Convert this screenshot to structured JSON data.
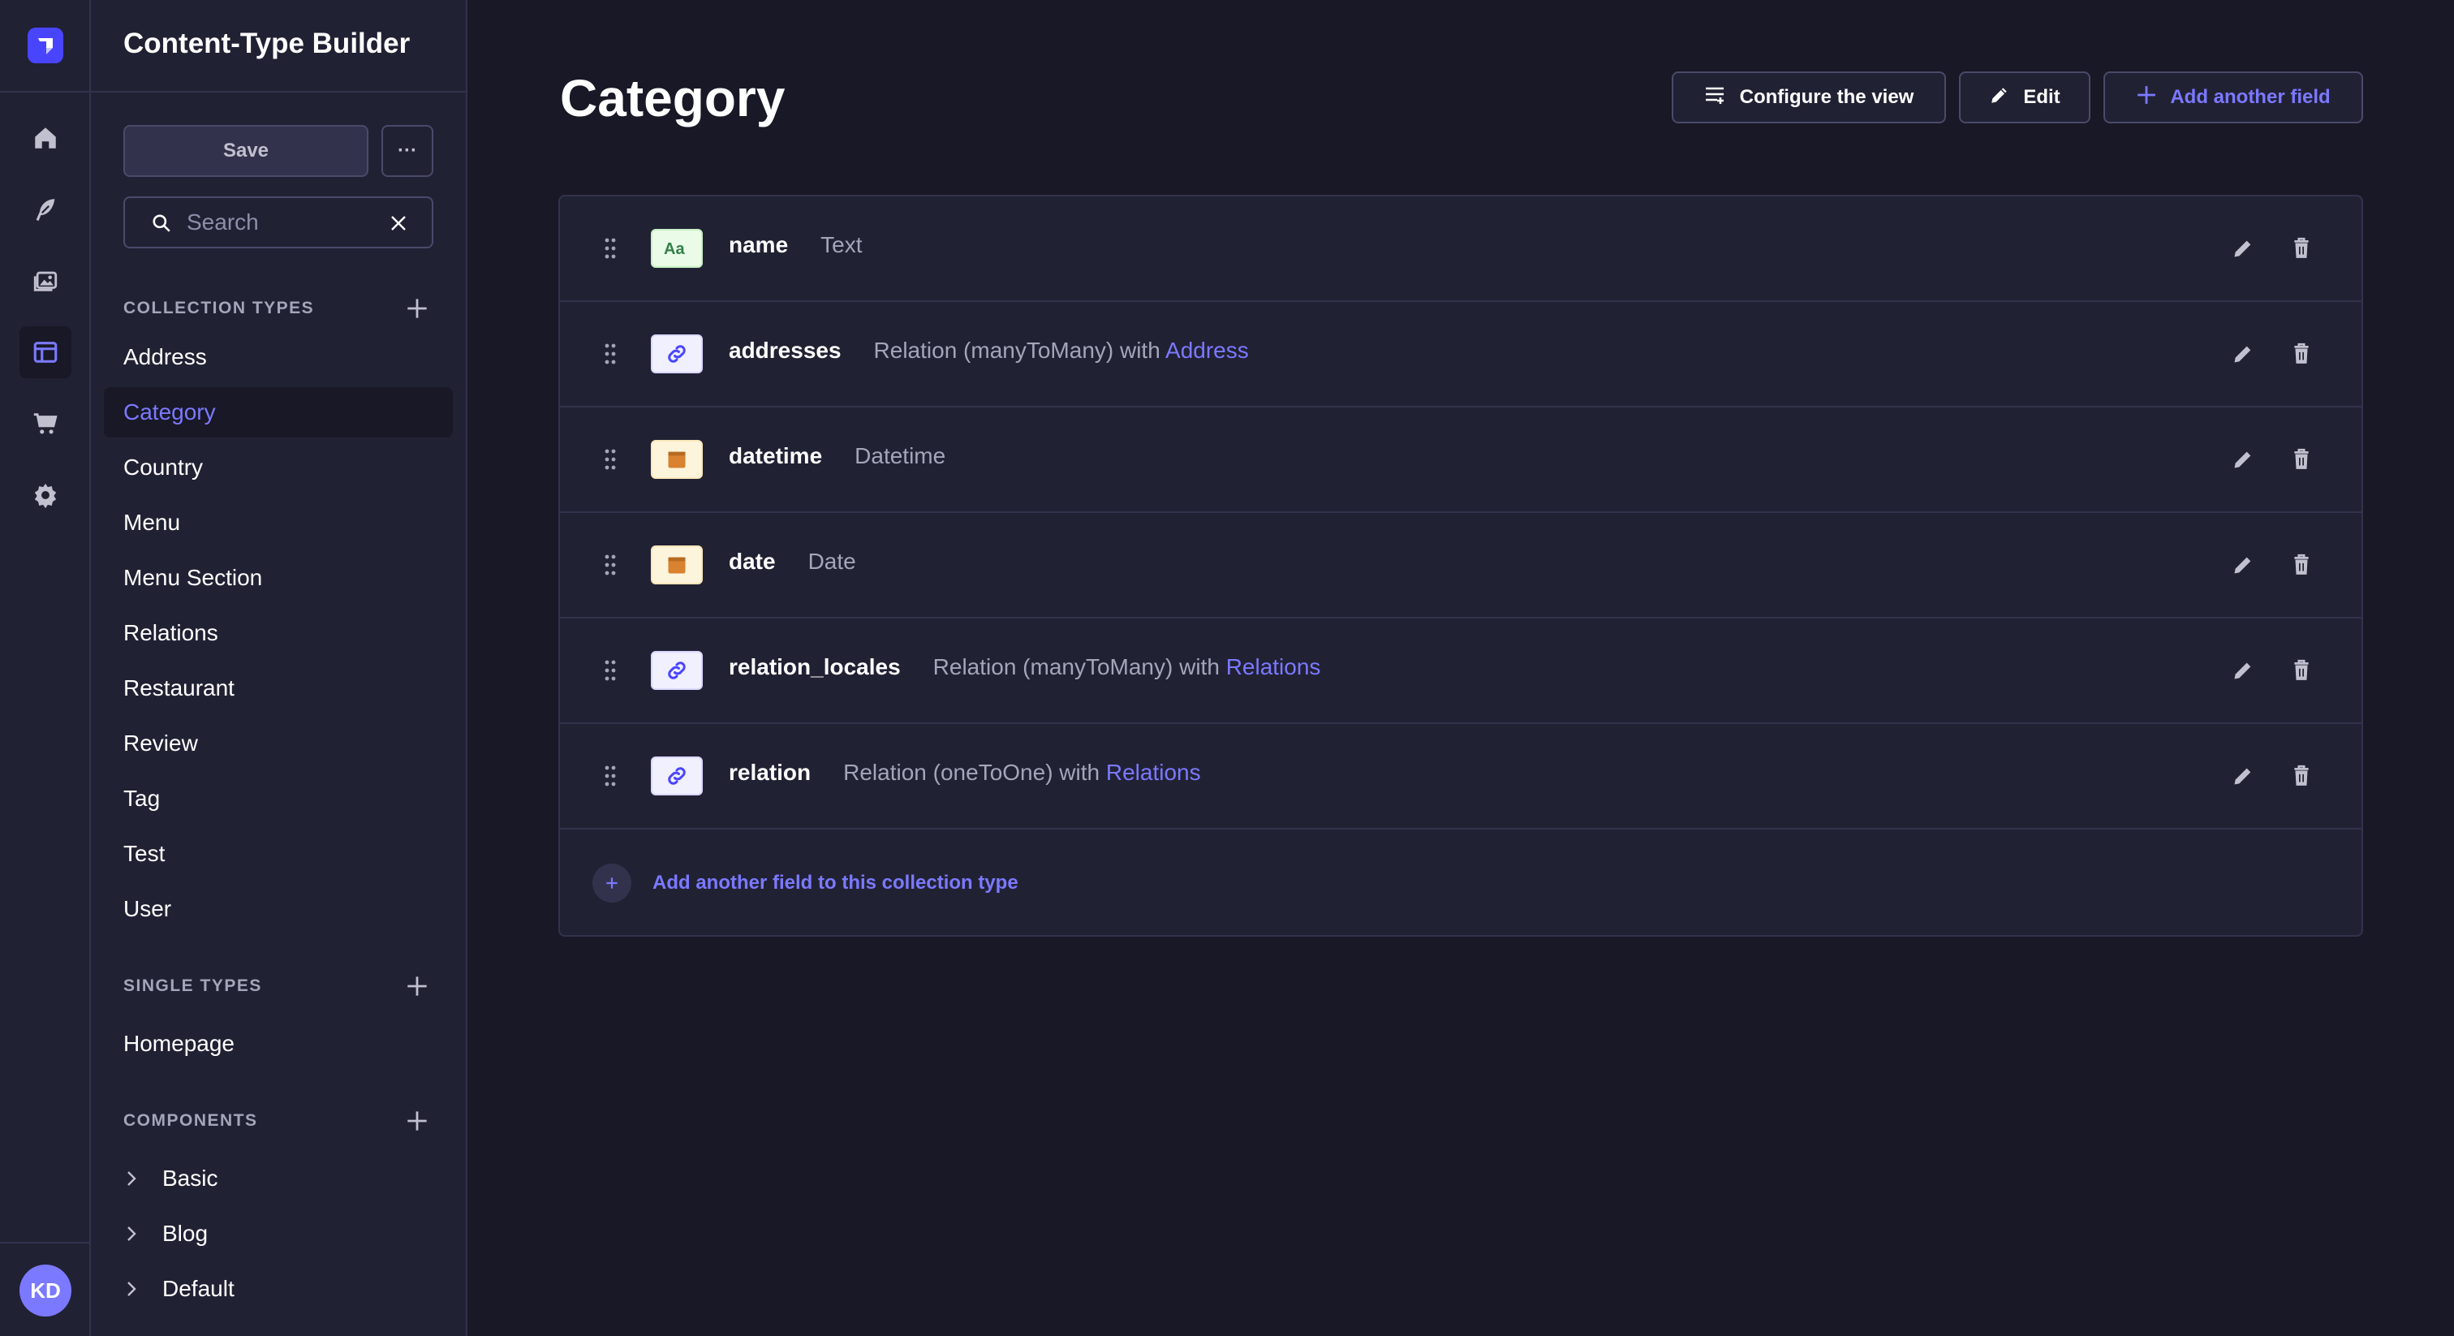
{
  "app": {
    "brand_color": "#4945ff",
    "accent_color": "#7b79ff",
    "background": "#181826",
    "surface": "#212134"
  },
  "rail": {
    "logo_icon": "strapi-logo-icon",
    "items": [
      {
        "icon": "home-icon"
      },
      {
        "icon": "feather-icon"
      },
      {
        "icon": "media-library-icon"
      },
      {
        "icon": "layout-icon",
        "active": true
      },
      {
        "icon": "cart-icon"
      },
      {
        "icon": "cog-icon"
      }
    ],
    "avatar_initials": "KD"
  },
  "subnav": {
    "title": "Content-Type Builder",
    "save_label": "Save",
    "more_label": "···",
    "search_placeholder": "Search",
    "collection_types": {
      "heading": "COLLECTION TYPES",
      "items": [
        "Address",
        "Category",
        "Country",
        "Menu",
        "Menu Section",
        "Relations",
        "Restaurant",
        "Review",
        "Tag",
        "Test",
        "User"
      ],
      "active": "Category"
    },
    "single_types": {
      "heading": "SINGLE TYPES",
      "items": [
        "Homepage"
      ]
    },
    "components": {
      "heading": "COMPONENTS",
      "items": [
        "Basic",
        "Blog",
        "Default"
      ]
    }
  },
  "main": {
    "title": "Category",
    "configure_label": "Configure the view",
    "edit_label": "Edit",
    "add_field_label": "Add another field",
    "add_to_type_label": "Add another field to this collection type",
    "fields": [
      {
        "name": "name",
        "type": "Text",
        "target": "",
        "icon": "text-icon"
      },
      {
        "name": "addresses",
        "type": "Relation (manyToMany) with",
        "target": "Address",
        "icon": "relation-icon"
      },
      {
        "name": "datetime",
        "type": "Datetime",
        "target": "",
        "icon": "date-icon"
      },
      {
        "name": "date",
        "type": "Date",
        "target": "",
        "icon": "date-icon"
      },
      {
        "name": "relation_locales",
        "type": "Relation (manyToMany) with",
        "target": "Relations",
        "icon": "relation-icon"
      },
      {
        "name": "relation",
        "type": "Relation (oneToOne) with",
        "target": "Relations",
        "icon": "relation-icon"
      }
    ]
  }
}
